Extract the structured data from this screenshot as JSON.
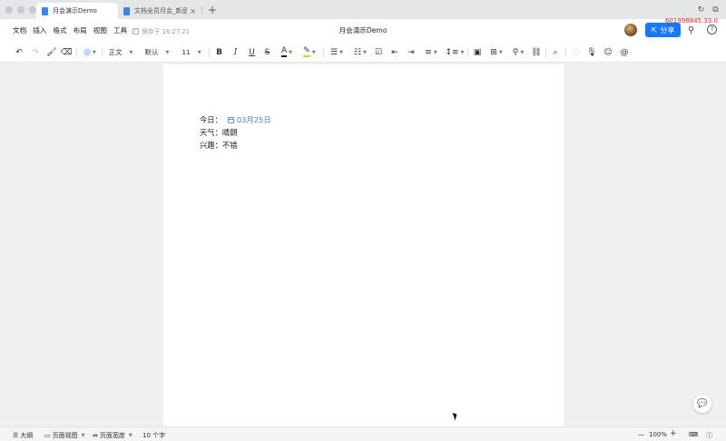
{
  "tabs": [
    {
      "label": "月会演示Demo",
      "active": true
    },
    {
      "label": "文档全员月会_新品",
      "active": false
    }
  ],
  "tab_add": "+",
  "menu": [
    "文档",
    "插入",
    "格式",
    "布局",
    "视图",
    "工具"
  ],
  "saved_status": "保存于 16:27:21",
  "doc_title": "月会演示Demo",
  "share_label": "分享",
  "overlay_text": "601998845.33.0",
  "toolbar": {
    "style": "正文",
    "font": "默认",
    "size": "11"
  },
  "content": {
    "line1_label": "今日：",
    "line1_date": "03月25日",
    "line2": "天气：晴朗",
    "line3": "兴趣：不错"
  },
  "status": {
    "outline": "大纲",
    "page_view": "页面视图",
    "page_width": "页面宽度",
    "word_count": "10 个字",
    "zoom": "100%",
    "zoom_minus": "—",
    "zoom_plus": "+"
  },
  "colors": {
    "accent": "#1677ff",
    "date_chip": "#4a7fd4",
    "overlay": "#e2261a"
  }
}
